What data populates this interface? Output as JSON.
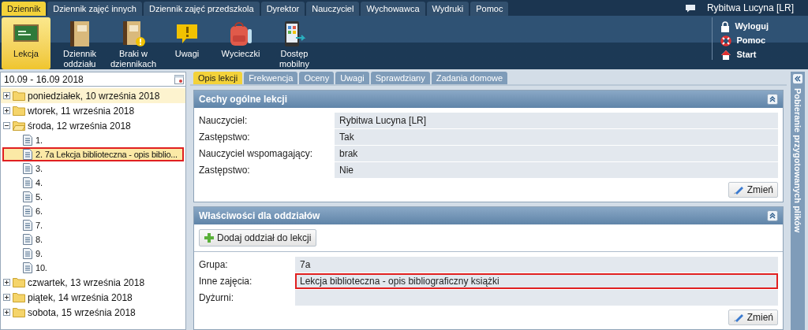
{
  "top_tabs": [
    {
      "label": "Dziennik",
      "selected": true
    },
    {
      "label": "Dziennik zajęć innych",
      "selected": false
    },
    {
      "label": "Dziennik zajęć przedszkola",
      "selected": false
    },
    {
      "label": "Dyrektor",
      "selected": false
    },
    {
      "label": "Nauczyciel",
      "selected": false
    },
    {
      "label": "Wychowawca",
      "selected": false
    },
    {
      "label": "Wydruki",
      "selected": false
    },
    {
      "label": "Pomoc",
      "selected": false
    }
  ],
  "user": {
    "name": "Rybitwa Lucyna [LR]"
  },
  "toolbar": [
    {
      "label": "Lekcja",
      "kind": "board",
      "selected": true
    },
    {
      "label": "Dziennik oddziału",
      "kind": "book",
      "selected": false
    },
    {
      "label": "Braki w dziennikach",
      "kind": "bookwarn",
      "selected": false
    },
    {
      "label": "Uwagi",
      "kind": "bubble",
      "selected": false
    },
    {
      "label": "Wycieczki",
      "kind": "backpack",
      "selected": false
    },
    {
      "label": "Dostęp mobilny",
      "kind": "phone",
      "selected": false
    }
  ],
  "quick_links": [
    {
      "label": "Wyloguj",
      "kind": "lock"
    },
    {
      "label": "Pomoc",
      "kind": "lifebuoy"
    },
    {
      "label": "Start",
      "kind": "home"
    }
  ],
  "date_range": {
    "value": "10.09 - 16.09 2018"
  },
  "tree": [
    {
      "label": "poniedziałek, 10 września 2018",
      "expanded": false,
      "hovered": true
    },
    {
      "label": "wtorek, 11 września 2018",
      "expanded": false,
      "hovered": false
    },
    {
      "label": "środa, 12 września 2018",
      "expanded": true,
      "hovered": false,
      "children": [
        {
          "label": "1.",
          "selected": false,
          "outlined": false
        },
        {
          "label": "2. 7a Lekcja biblioteczna - opis biblio...",
          "selected": true,
          "outlined": true
        },
        {
          "label": "3.",
          "selected": false,
          "outlined": false
        },
        {
          "label": "4.",
          "selected": false,
          "outlined": false
        },
        {
          "label": "5.",
          "selected": false,
          "outlined": false
        },
        {
          "label": "6.",
          "selected": false,
          "outlined": false
        },
        {
          "label": "7.",
          "selected": false,
          "outlined": false
        },
        {
          "label": "8.",
          "selected": false,
          "outlined": false
        },
        {
          "label": "9.",
          "selected": false,
          "outlined": false
        },
        {
          "label": "10.",
          "selected": false,
          "outlined": false
        }
      ]
    },
    {
      "label": "czwartek, 13 września 2018",
      "expanded": false,
      "hovered": false
    },
    {
      "label": "piątek, 14 września 2018",
      "expanded": false,
      "hovered": false
    },
    {
      "label": "sobota, 15 września 2018",
      "expanded": false,
      "hovered": false
    }
  ],
  "lesson_tabs": [
    {
      "label": "Opis lekcji",
      "selected": true
    },
    {
      "label": "Frekwencja",
      "selected": false
    },
    {
      "label": "Oceny",
      "selected": false
    },
    {
      "label": "Uwagi",
      "selected": false
    },
    {
      "label": "Sprawdziany",
      "selected": false
    },
    {
      "label": "Zadania domowe",
      "selected": false
    }
  ],
  "panels": [
    {
      "title": "Cechy ogólne lekcji",
      "fields": [
        {
          "label": "Nauczyciel:",
          "value": "Rybitwa Lucyna [LR]",
          "outlined": false
        },
        {
          "label": "Zastępstwo:",
          "value": "Tak",
          "outlined": false
        },
        {
          "label": "Nauczyciel wspomagający:",
          "value": "brak",
          "outlined": false
        },
        {
          "label": "Zastępstwo:",
          "value": "Nie",
          "outlined": false
        }
      ],
      "button": "Zmień"
    },
    {
      "title": "Właściwości dla oddziałów",
      "add_button": "Dodaj oddział do lekcji",
      "fields": [
        {
          "label": "Grupa:",
          "value": "7a",
          "outlined": false
        },
        {
          "label": "Inne zajęcia:",
          "value": "Lekcja biblioteczna - opis bibliograficzny książki",
          "outlined": true
        },
        {
          "label": "Dyżurni:",
          "outlined": false
        }
      ],
      "button": "Zmień"
    }
  ],
  "side_panel": {
    "title": "Pobieranie przygotowanych plików"
  }
}
